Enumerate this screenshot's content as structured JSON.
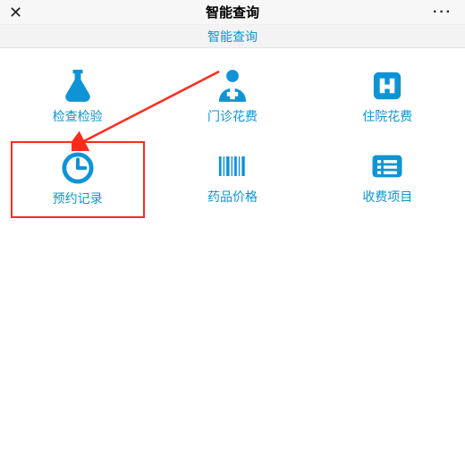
{
  "header": {
    "close_glyph": "✕",
    "title": "智能查询",
    "more_glyph": "···"
  },
  "subheader": {
    "title": "智能查询"
  },
  "colors": {
    "accent": "#0e94d6",
    "highlight": "#ff2a1a"
  },
  "grid": {
    "items": [
      {
        "id": "inspection",
        "label": "检查检验",
        "icon": "flask-icon",
        "highlighted": false
      },
      {
        "id": "outpatient",
        "label": "门诊花费",
        "icon": "doctor-icon",
        "highlighted": false
      },
      {
        "id": "inpatient",
        "label": "住院花费",
        "icon": "hospital-icon",
        "highlighted": false
      },
      {
        "id": "appointment",
        "label": "预约记录",
        "icon": "clock-icon",
        "highlighted": true
      },
      {
        "id": "drug-price",
        "label": "药品价格",
        "icon": "barcode-icon",
        "highlighted": false
      },
      {
        "id": "fee-item",
        "label": "收费项目",
        "icon": "list-box-icon",
        "highlighted": false
      }
    ]
  }
}
